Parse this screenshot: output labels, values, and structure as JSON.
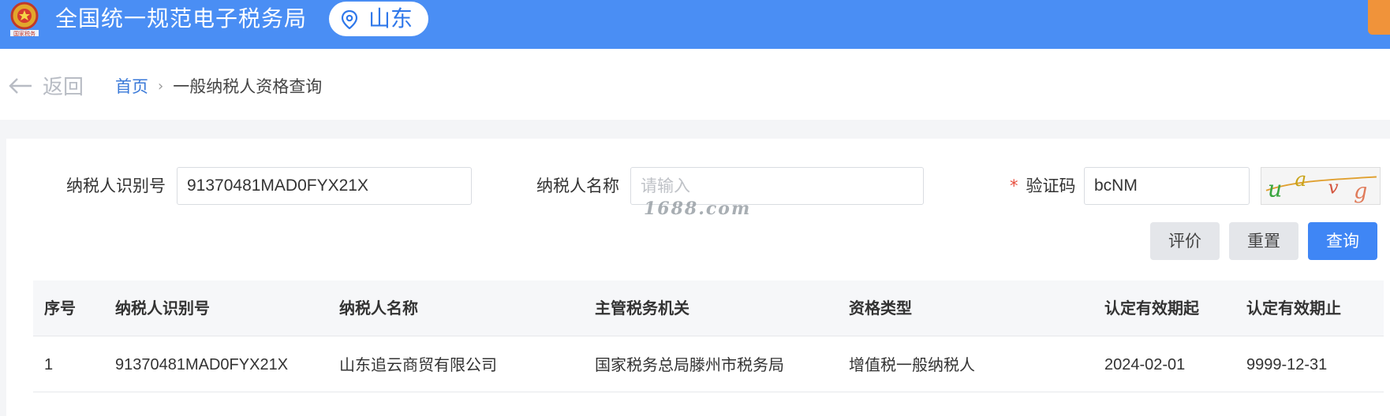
{
  "header": {
    "title": "全国统一规范电子税务局",
    "region": "山东"
  },
  "nav": {
    "back_label": "返回",
    "breadcrumb_home": "首页",
    "breadcrumb_separator": "›",
    "breadcrumb_current": "一般纳税人资格查询"
  },
  "form": {
    "taxpayer_id_label": "纳税人识别号",
    "taxpayer_id_value": "91370481MAD0FYX21X",
    "taxpayer_name_label": "纳税人名称",
    "taxpayer_name_placeholder": "请输入",
    "captcha_required_mark": "*",
    "captcha_label": "验证码",
    "captcha_value": "bcNM",
    "watermark": "1688.com"
  },
  "buttons": {
    "evaluate": "评价",
    "reset": "重置",
    "query": "查询"
  },
  "table": {
    "columns": [
      "序号",
      "纳税人识别号",
      "纳税人名称",
      "主管税务机关",
      "资格类型",
      "认定有效期起",
      "认定有效期止"
    ],
    "rows": [
      [
        "1",
        "91370481MAD0FYX21X",
        "山东追云商贸有限公司",
        "国家税务总局滕州市税务局",
        "增值税一般纳税人",
        "2024-02-01",
        "9999-12-31"
      ]
    ]
  },
  "colors": {
    "header_blue": "#4a8ef4",
    "primary_button": "#3f86f5",
    "link_blue": "#3a79d8",
    "required_red": "#e74c3c"
  }
}
